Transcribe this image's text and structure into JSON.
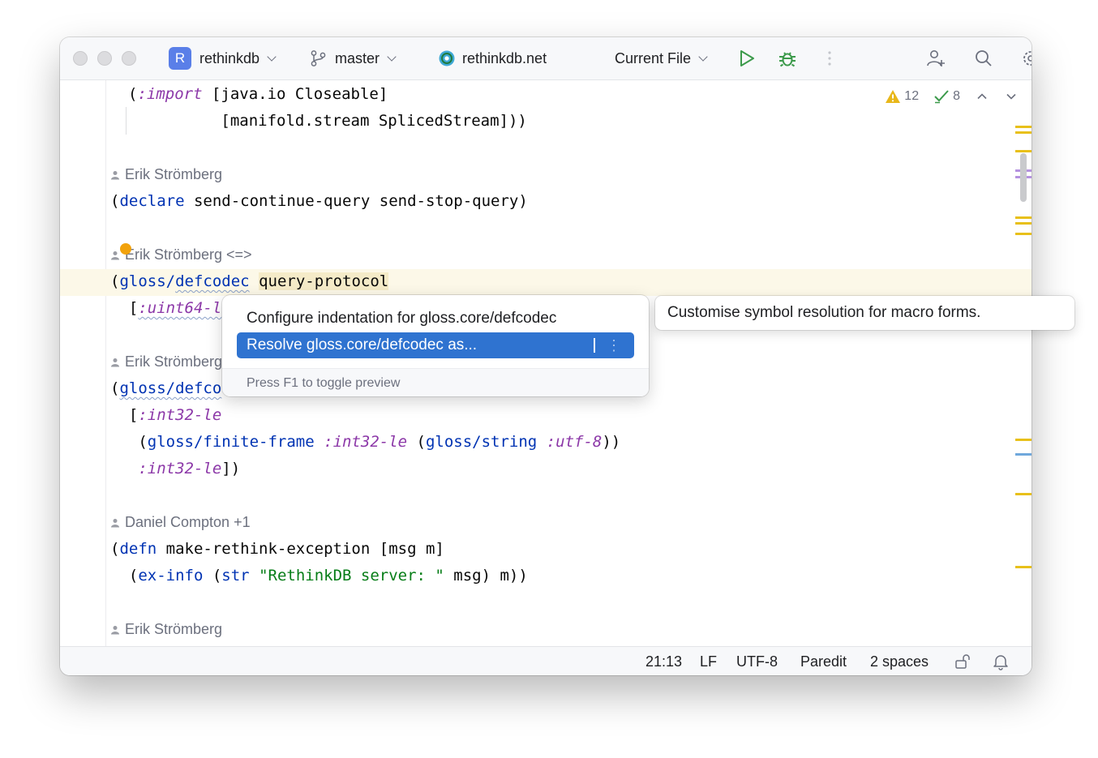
{
  "window": {
    "project_initial": "R",
    "project_name": "rethinkdb",
    "branch": "master",
    "remote": "rethinkdb.net",
    "run_config": "Current File",
    "icons": [
      "branch-icon",
      "globe-icon",
      "run-icon",
      "debug-icon",
      "more-icon",
      "add-user-icon",
      "search-icon",
      "settings-icon"
    ]
  },
  "editor": {
    "problems": {
      "warnings": "12",
      "ok": "8"
    },
    "lines": {
      "l1_open": "(",
      "l1_kw": ":import",
      "l1_rest": " [java.io Closeable]",
      "l2": "          [manifold.stream SplicedStream]))",
      "a1": "Erik Strömberg",
      "l3_open": "(",
      "l3_fn": "declare",
      "l3_rest": " send-continue-query send-stop-query)",
      "a2": "Erik Strömberg <=>",
      "l4_open": "(",
      "l4_ns": "gloss/",
      "l4_fn": "defcodec",
      "l4_sp": " ",
      "l4_sym": "query-protocol",
      "l5_open": "  [",
      "l5_kw": ":uint64-l",
      "a3": "Erik Strömberg",
      "l6_open": "(",
      "l6_fn": "gloss/defco",
      "l7_open": "  [",
      "l7_kw": ":int32-le",
      "l8_open": "   (",
      "l8_fn": "gloss/finite-frame",
      "l8_sp1": " ",
      "l8_kw1": ":int32-le",
      "l8_sp2": " (",
      "l8_fn2": "gloss/string",
      "l8_sp3": " ",
      "l8_kw2": ":utf-8",
      "l8_close": "))",
      "l9_open": "   ",
      "l9_kw": ":int32-le",
      "l9_close": "])",
      "a4": "Daniel Compton +1",
      "l10_open": "(",
      "l10_fn": "defn",
      "l10_rest": " make-rethink-exception [msg m]",
      "l11_open": "  (",
      "l11_fn": "ex-info",
      "l11_sp": " (",
      "l11_fn2": "str",
      "l11_sp2": " ",
      "l11_str": "\"RethinkDB server: \"",
      "l11_close": " msg) m))",
      "a5": "Erik Strömberg"
    }
  },
  "popup": {
    "item1": "Configure indentation for gloss.core/defcodec",
    "item2": "Resolve gloss.core/defcodec as...",
    "more": "⋮",
    "footer": "Press F1 to toggle preview"
  },
  "tooltip": "Customise symbol resolution for macro forms.",
  "status": {
    "position": "21:13",
    "line_sep": "LF",
    "encoding": "UTF-8",
    "mode": "Paredit",
    "indent": "2 spaces"
  },
  "colors": {
    "accent": "#2f73d0",
    "keyword": "#8c38a8",
    "function": "#0033b3",
    "string": "#067d17",
    "warning": "#e8b71a"
  }
}
